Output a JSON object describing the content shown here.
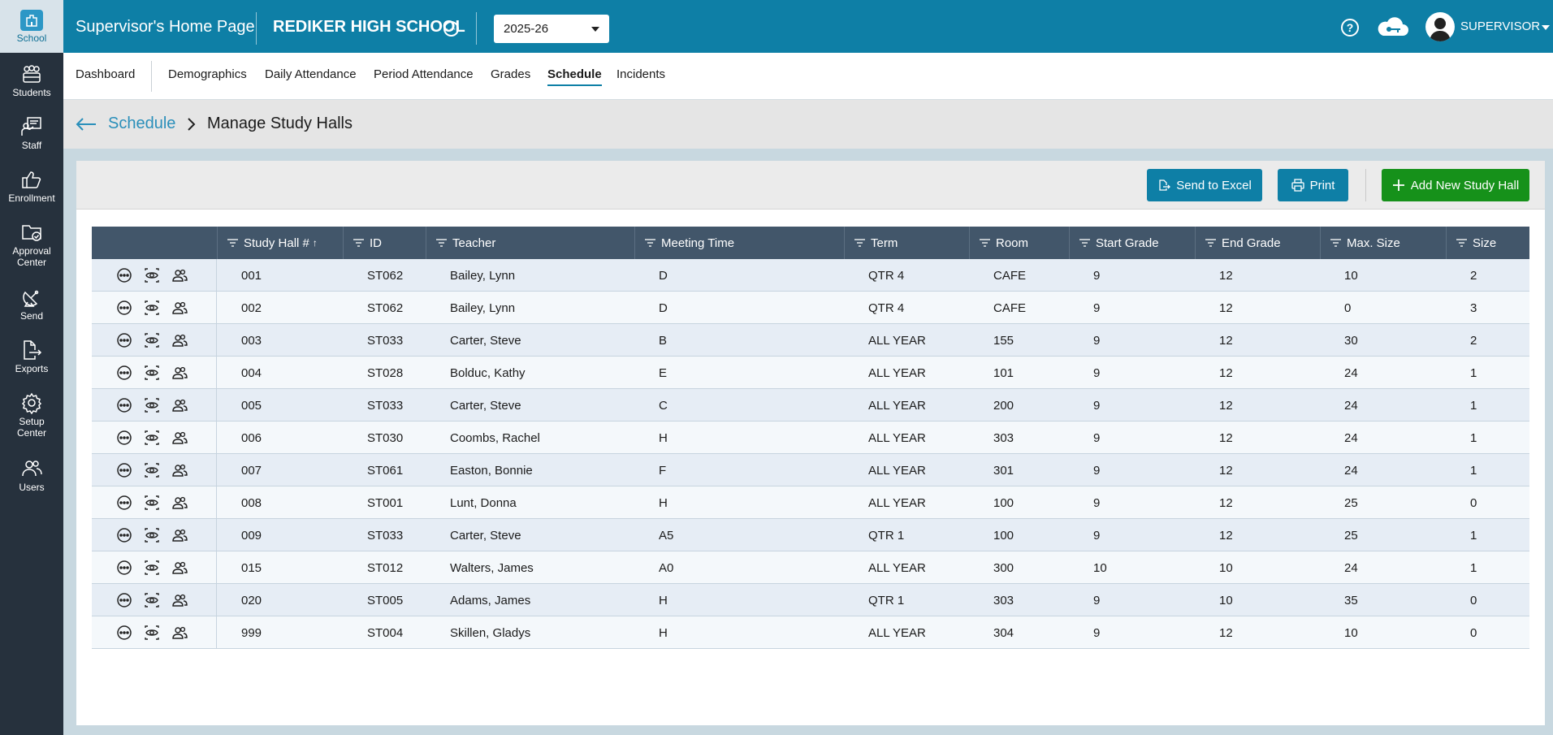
{
  "sidebar": {
    "items": [
      {
        "label": "School",
        "icon": "school-icon"
      },
      {
        "label": "Students",
        "icon": "students-icon"
      },
      {
        "label": "Staff",
        "icon": "staff-icon"
      },
      {
        "label": "Enrollment",
        "icon": "thumbs-up-icon"
      },
      {
        "label": "Approval Center",
        "icon": "folder-check-icon"
      },
      {
        "label": "Send",
        "icon": "satellite-dish-icon"
      },
      {
        "label": "Exports",
        "icon": "export-file-icon"
      },
      {
        "label": "Setup Center",
        "icon": "gear-icon"
      },
      {
        "label": "Users",
        "icon": "users-icon"
      }
    ]
  },
  "header": {
    "title": "Supervisor's Home Page",
    "school": "REDIKER HIGH SCHOOL",
    "year": "2025-26",
    "user": "SUPERVISOR"
  },
  "tabs": [
    {
      "label": "Dashboard"
    },
    {
      "label": "Demographics"
    },
    {
      "label": "Daily Attendance"
    },
    {
      "label": "Period Attendance"
    },
    {
      "label": "Grades"
    },
    {
      "label": "Schedule",
      "active": true
    },
    {
      "label": "Incidents"
    }
  ],
  "breadcrumb": {
    "parent": "Schedule",
    "current": "Manage Study Halls"
  },
  "toolbar": {
    "excel": "Send to Excel",
    "print": "Print",
    "add": "Add New Study Hall"
  },
  "colors": {
    "brand": "#0e7fa6",
    "sidebar": "#26313d",
    "add_button": "#16911a",
    "table_header": "#42566a"
  },
  "table": {
    "columns": [
      "Study Hall #",
      "ID",
      "Teacher",
      "Meeting Time",
      "Term",
      "Room",
      "Start Grade",
      "End Grade",
      "Max. Size",
      "Size"
    ],
    "sorted_column": "Study Hall #",
    "sort_direction": "ascending",
    "rows": [
      [
        "001",
        "ST062",
        "Bailey, Lynn",
        "D",
        "QTR 4",
        "CAFE",
        "9",
        "12",
        "10",
        "2"
      ],
      [
        "002",
        "ST062",
        "Bailey, Lynn",
        "D",
        "QTR 4",
        "CAFE",
        "9",
        "12",
        "0",
        "3"
      ],
      [
        "003",
        "ST033",
        "Carter, Steve",
        "B",
        "ALL YEAR",
        "155",
        "9",
        "12",
        "30",
        "2"
      ],
      [
        "004",
        "ST028",
        "Bolduc, Kathy",
        "E",
        "ALL YEAR",
        "101",
        "9",
        "12",
        "24",
        "1"
      ],
      [
        "005",
        "ST033",
        "Carter, Steve",
        "C",
        "ALL YEAR",
        "200",
        "9",
        "12",
        "24",
        "1"
      ],
      [
        "006",
        "ST030",
        "Coombs, Rachel",
        "H",
        "ALL YEAR",
        "303",
        "9",
        "12",
        "24",
        "1"
      ],
      [
        "007",
        "ST061",
        "Easton, Bonnie",
        "F",
        "ALL YEAR",
        "301",
        "9",
        "12",
        "24",
        "1"
      ],
      [
        "008",
        "ST001",
        "Lunt, Donna",
        "H",
        "ALL YEAR",
        "100",
        "9",
        "12",
        "25",
        "0"
      ],
      [
        "009",
        "ST033",
        "Carter, Steve",
        "A5",
        "QTR 1",
        "100",
        "9",
        "12",
        "25",
        "1"
      ],
      [
        "015",
        "ST012",
        "Walters, James",
        "A0",
        "ALL YEAR",
        "300",
        "10",
        "10",
        "24",
        "1"
      ],
      [
        "020",
        "ST005",
        "Adams, James",
        "H",
        "QTR 1",
        "303",
        "9",
        "10",
        "35",
        "0"
      ],
      [
        "999",
        "ST004",
        "Skillen, Gladys",
        "H",
        "ALL YEAR",
        "304",
        "9",
        "12",
        "10",
        "0"
      ]
    ]
  }
}
